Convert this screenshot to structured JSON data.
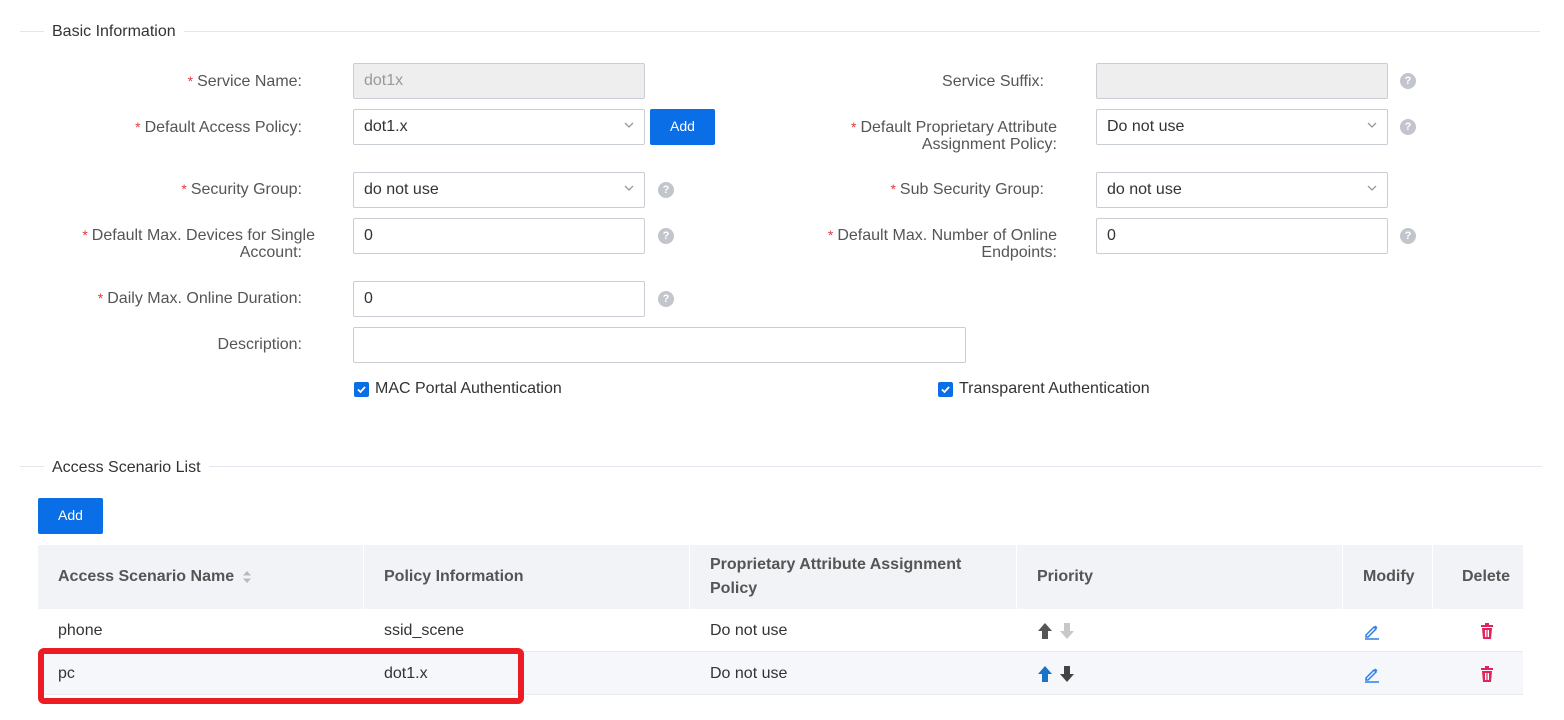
{
  "basic": {
    "title": "Basic Information",
    "service_name": {
      "label": "Service Name:",
      "value": "dot1x"
    },
    "service_suffix": {
      "label": "Service Suffix:",
      "value": ""
    },
    "default_access_policy": {
      "label": "Default Access Policy:",
      "value": "dot1.x",
      "add_label": "Add"
    },
    "default_proprietary": {
      "label_line1": "Default Proprietary Attribute",
      "label_line2": "Assignment Policy:",
      "value": "Do not use"
    },
    "security_group": {
      "label": "Security Group:",
      "value": "do not use"
    },
    "sub_security_group": {
      "label": "Sub Security Group:",
      "value": "do not use"
    },
    "max_devices": {
      "label_line1": "Default Max. Devices for Single",
      "label_line2": "Account:",
      "value": "0"
    },
    "max_online": {
      "label_line1": "Default Max. Number of Online",
      "label_line2": "Endpoints:",
      "value": "0"
    },
    "daily_max": {
      "label": "Daily Max. Online Duration:",
      "value": "0"
    },
    "description": {
      "label": "Description:",
      "value": ""
    },
    "mac_portal": {
      "label": "MAC Portal Authentication",
      "checked": true
    },
    "transparent": {
      "label": "Transparent Authentication",
      "checked": true
    },
    "help_glyph": "?",
    "required_mark": "*"
  },
  "scenario": {
    "title": "Access Scenario List",
    "add_label": "Add",
    "columns": {
      "name": "Access Scenario Name",
      "policy": "Policy Information",
      "proprietary_line1": "Proprietary Attribute Assignment",
      "proprietary_line2": "Policy",
      "priority": "Priority",
      "modify": "Modify",
      "delete": "Delete"
    },
    "rows": [
      {
        "name": "phone",
        "policy": "ssid_scene",
        "proprietary": "Do not use"
      },
      {
        "name": "pc",
        "policy": "dot1.x",
        "proprietary": "Do not use"
      }
    ]
  },
  "colors": {
    "accent": "#0a6ee6",
    "required": "#e4393c",
    "highlight": "#ec1c24",
    "delete": "#e0245e"
  }
}
